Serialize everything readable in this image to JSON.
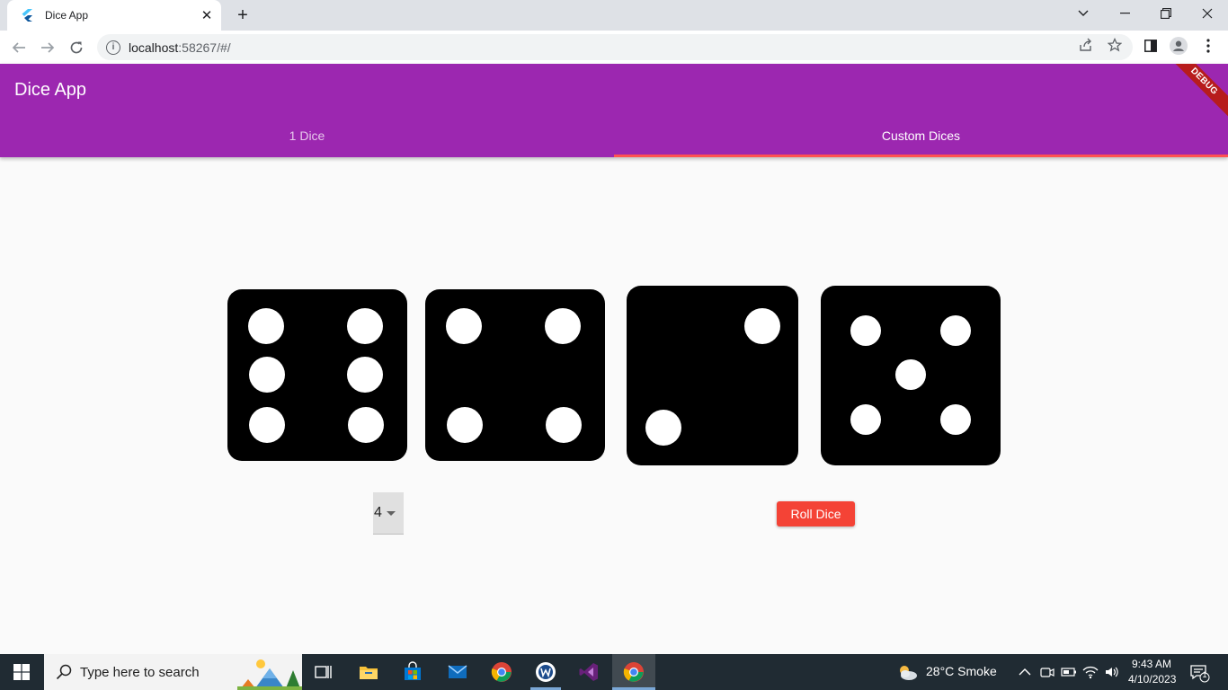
{
  "browser": {
    "tab_title": "Dice App",
    "tab_close": "✕",
    "new_tab": "+",
    "url_host": "localhost",
    "url_rest": ":58267/#/"
  },
  "app": {
    "title": "Dice App",
    "tabs": [
      {
        "label": "1 Dice",
        "active": false
      },
      {
        "label": "Custom Dices",
        "active": true
      }
    ],
    "debug_banner": "DEBUG",
    "dice_values": [
      6,
      4,
      2,
      5
    ],
    "dropdown_value": "4",
    "roll_button": "Roll Dice",
    "colors": {
      "appbar": "#9c27b0",
      "indicator": "#ff5252",
      "roll_button": "#f44336"
    }
  },
  "taskbar": {
    "search_placeholder": "Type here to search",
    "weather": "28°C  Smoke",
    "time": "9:43 AM",
    "date": "4/10/2023",
    "notification_count": "1"
  }
}
